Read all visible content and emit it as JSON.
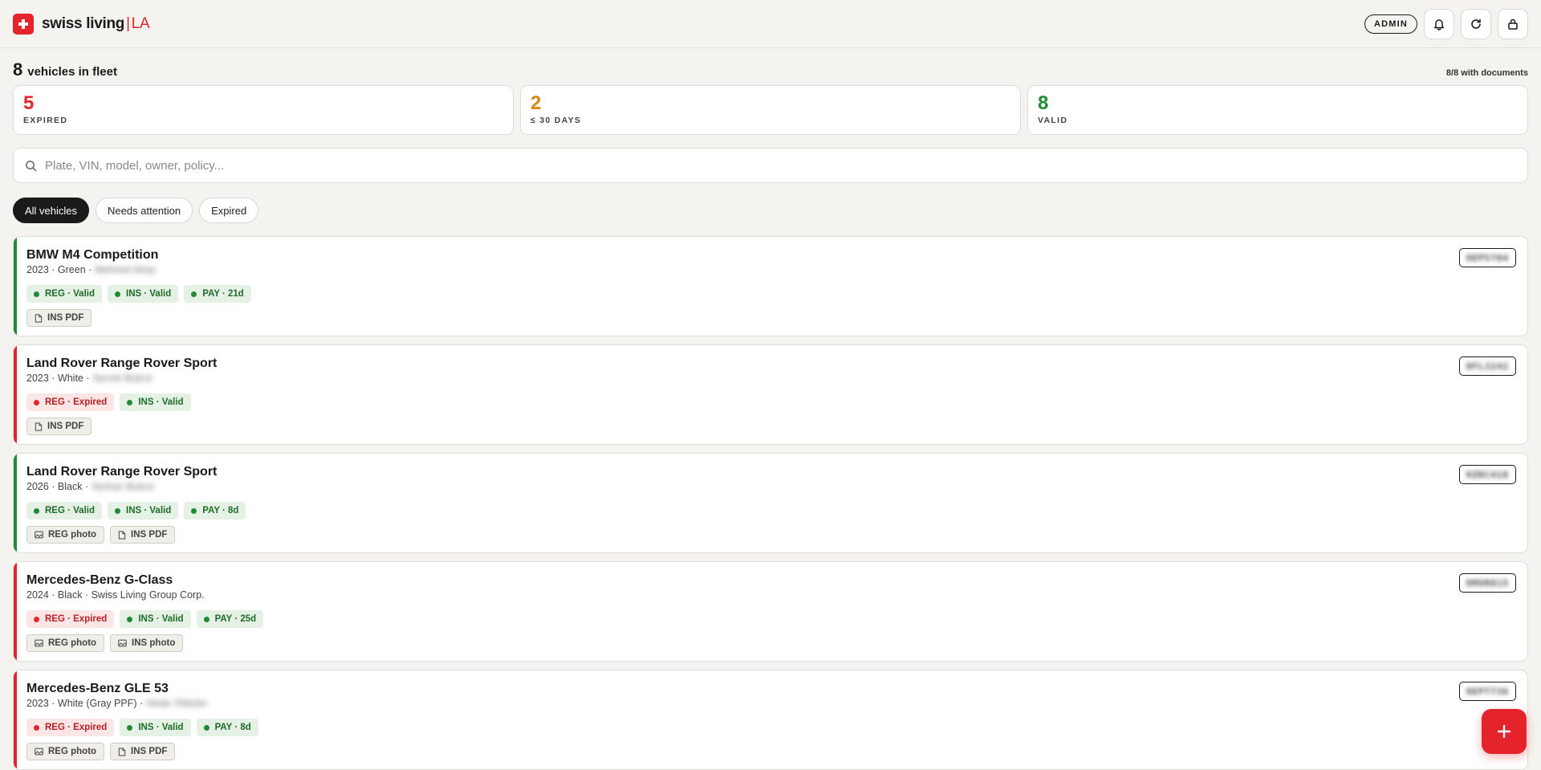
{
  "header": {
    "brand": "swiss living",
    "separator": "|",
    "location": "LA",
    "role_badge": "ADMIN",
    "icons": [
      "plus-cross-icon",
      "bell-icon",
      "refresh-icon",
      "lock-icon"
    ]
  },
  "fleet": {
    "count": "8",
    "label": "vehicles in fleet",
    "docs_note": "8/8 with documents"
  },
  "stats": [
    {
      "value": "5",
      "label": "EXPIRED",
      "color": "#e4232b"
    },
    {
      "value": "2",
      "label": "≤ 30 DAYS",
      "color": "#d9860b"
    },
    {
      "value": "8",
      "label": "VALID",
      "color": "#1f8a35"
    }
  ],
  "search": {
    "placeholder": "Plate, VIN, model, owner, policy..."
  },
  "filters": [
    {
      "label": "All vehicles",
      "active": true
    },
    {
      "label": "Needs attention",
      "active": false
    },
    {
      "label": "Expired",
      "active": false
    }
  ],
  "vehicles": [
    {
      "title": "BMW M4 Competition",
      "year_color": "2023 · Green ·",
      "owner": "Mehmet Akay",
      "plate": "9EP5784",
      "stripe": "#1f8a35",
      "badges": [
        {
          "text": "REG · Valid",
          "status": "ok"
        },
        {
          "text": "INS · Valid",
          "status": "ok"
        },
        {
          "text": "PAY · 21d",
          "status": "ok"
        }
      ],
      "docs": [
        {
          "text": "INS PDF",
          "icon": "pdf-file-icon"
        }
      ]
    },
    {
      "title": "Land Rover Range Rover Sport",
      "year_color": "2023 · White ·",
      "owner": "Servet Bukce",
      "plate": "9FLJ242",
      "stripe": "#e4232b",
      "badges": [
        {
          "text": "REG · Expired",
          "status": "bad"
        },
        {
          "text": "INS · Valid",
          "status": "ok"
        }
      ],
      "docs": [
        {
          "text": "INS PDF",
          "icon": "pdf-file-icon"
        }
      ]
    },
    {
      "title": "Land Rover Range Rover Sport",
      "year_color": "2026 · Black ·",
      "owner": "Serkan Bukce",
      "plate": "9ZRC418",
      "stripe": "#1f8a35",
      "badges": [
        {
          "text": "REG · Valid",
          "status": "ok"
        },
        {
          "text": "INS · Valid",
          "status": "ok"
        },
        {
          "text": "PAY · 8d",
          "status": "ok"
        }
      ],
      "docs": [
        {
          "text": "REG photo",
          "icon": "image-icon"
        },
        {
          "text": "INS PDF",
          "icon": "pdf-file-icon"
        }
      ]
    },
    {
      "title": "Mercedes-Benz G-Class",
      "year_color": "2024 · Black · Swiss Living Group Corp.",
      "owner": "",
      "plate": "9MVR815",
      "stripe": "#e4232b",
      "badges": [
        {
          "text": "REG · Expired",
          "status": "bad"
        },
        {
          "text": "INS · Valid",
          "status": "ok"
        },
        {
          "text": "PAY · 25d",
          "status": "ok"
        }
      ],
      "docs": [
        {
          "text": "REG photo",
          "icon": "image-icon"
        },
        {
          "text": "INS photo",
          "icon": "image-icon"
        }
      ]
    },
    {
      "title": "Mercedes-Benz GLE 53",
      "year_color": "2023 · White (Gray PPF) ·",
      "owner": "Neda Yildizler",
      "plate": "9EPT736",
      "stripe": "#e4232b",
      "badges": [
        {
          "text": "REG · Expired",
          "status": "bad"
        },
        {
          "text": "INS · Valid",
          "status": "ok"
        },
        {
          "text": "PAY · 8d",
          "status": "ok"
        }
      ],
      "docs": [
        {
          "text": "REG photo",
          "icon": "image-icon"
        },
        {
          "text": "INS PDF",
          "icon": "pdf-file-icon"
        }
      ]
    }
  ],
  "fab": {
    "icon": "plus-icon"
  }
}
